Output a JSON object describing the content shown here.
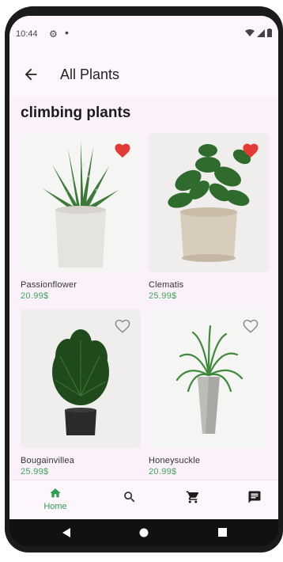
{
  "status": {
    "time": "10:44"
  },
  "app_bar": {
    "title": "All Plants"
  },
  "section": {
    "title": "climbing plants"
  },
  "plants": [
    {
      "name": "Passionflower",
      "price": "20.99$",
      "favorite": true
    },
    {
      "name": "Clematis",
      "price": "25.99$",
      "favorite": true
    },
    {
      "name": "Bougainvillea",
      "price": "25.99$",
      "favorite": false
    },
    {
      "name": "Honeysuckle",
      "price": "20.99$",
      "favorite": false
    }
  ],
  "bottom_nav": {
    "items": [
      {
        "label": "Home",
        "icon": "home-icon",
        "active": true
      },
      {
        "label": "",
        "icon": "search-icon",
        "active": false
      },
      {
        "label": "",
        "icon": "cart-icon",
        "active": false
      },
      {
        "label": "",
        "icon": "chat-icon",
        "active": false
      }
    ]
  },
  "colors": {
    "accent": "#2e9e52",
    "price": "#3fa55a",
    "heart": "#e53935",
    "background": "#fbf1fb"
  }
}
